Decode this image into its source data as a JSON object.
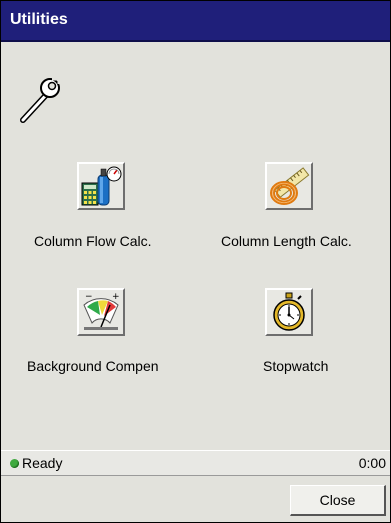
{
  "window": {
    "title": "Utilities"
  },
  "tools": [
    {
      "label": "Column Flow Calc.",
      "icon": "column-flow-calc-icon"
    },
    {
      "label": "Column Length Calc.",
      "icon": "column-length-calc-icon"
    },
    {
      "label": "Background Compen",
      "icon": "background-compensation-icon"
    },
    {
      "label": "Stopwatch",
      "icon": "stopwatch-icon"
    }
  ],
  "header_icon": "wrench-icon",
  "status": {
    "text": "Ready",
    "time": "0:00",
    "indicator_color": "#3faa3f"
  },
  "footer": {
    "close_label": "Close"
  },
  "colors": {
    "titlebar": "#1f1f7a",
    "background": "#e2e2dc"
  }
}
